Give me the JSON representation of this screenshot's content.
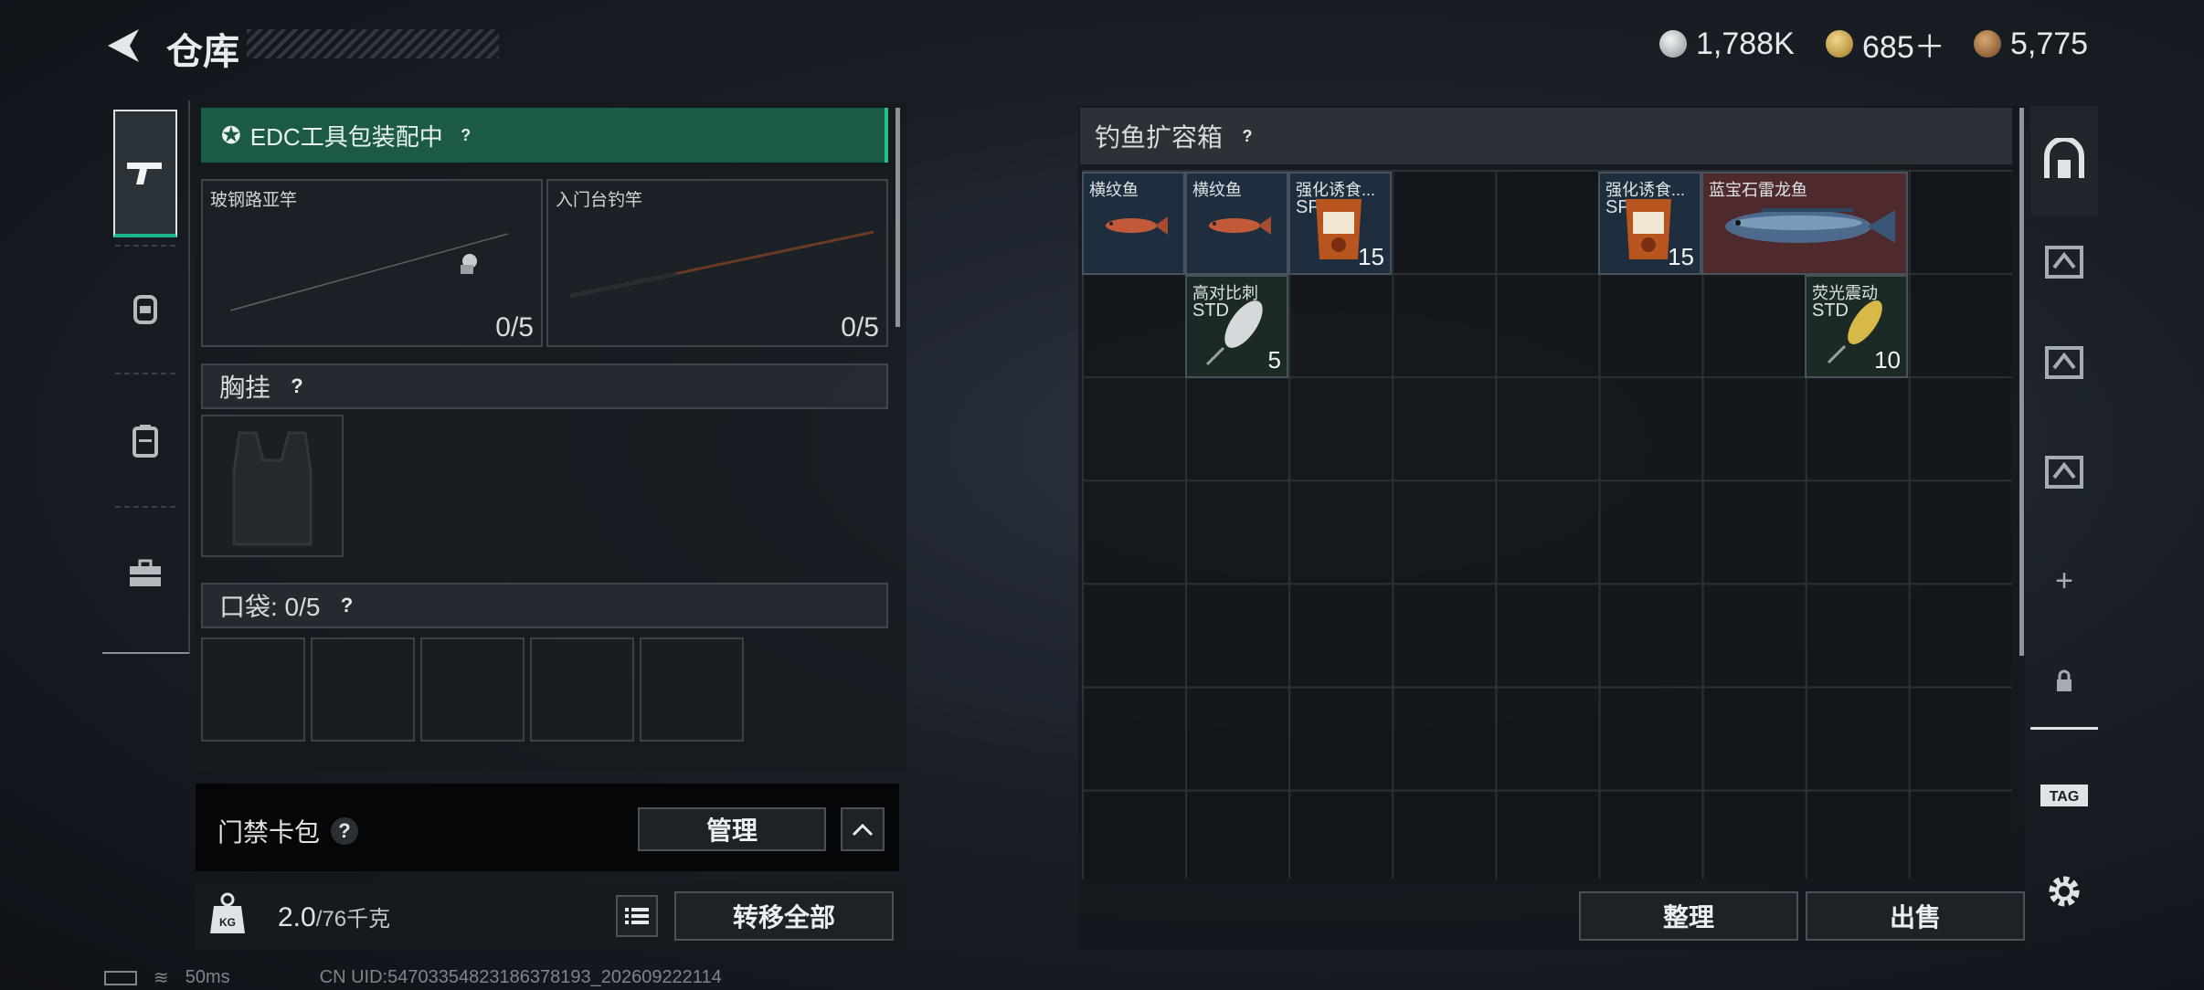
{
  "header": {
    "title": "仓库",
    "currencies": [
      {
        "icon": "silver-coin-icon",
        "value": "1,788K",
        "color": "#c9ccce"
      },
      {
        "icon": "gold-triangle-coin-icon",
        "value": "685＋",
        "color": "#d2a94a"
      },
      {
        "icon": "bronze-coin-icon",
        "value": "5,775",
        "color": "#a87b45"
      }
    ]
  },
  "left_tabs": [
    {
      "icon": "gun-icon",
      "active": true
    },
    {
      "icon": "helmet-icon"
    },
    {
      "icon": "backpack-icon"
    },
    {
      "icon": "toolbox-icon"
    }
  ],
  "loadout": {
    "edc_banner": "EDC工具包装配中",
    "rods": [
      {
        "name": "玻钢路亚竿",
        "count": "0/5"
      },
      {
        "name": "入门台钓竿",
        "count": "0/5"
      }
    ],
    "chest_rig_label": "胸挂",
    "pocket_label": "口袋: 0/5",
    "help": "?"
  },
  "keycard": {
    "label": "门禁卡包",
    "manage_label": "管理"
  },
  "capacity": {
    "current": "2.0",
    "max": "/76千克",
    "transfer_label": "转移全部"
  },
  "stash": {
    "title": "钓鱼扩容箱",
    "items": [
      {
        "name": "横纹鱼",
        "tag": "",
        "count": ""
      },
      {
        "name": "横纹鱼",
        "tag": "",
        "count": ""
      },
      {
        "name": "强化诱食...",
        "tag": "SP",
        "count": "15"
      },
      {
        "name": "强化诱食...",
        "tag": "SP",
        "count": "15"
      },
      {
        "name": "蓝宝石雷龙鱼",
        "tag": "",
        "count": ""
      },
      {
        "name": "高对比刺",
        "tag": "STD",
        "count": "5"
      },
      {
        "name": "荧光震动",
        "tag": "STD",
        "count": "10"
      }
    ],
    "sort_label": "整理",
    "sell_label": "出售"
  },
  "right_nav": [
    {
      "icon": "stash-home-icon"
    },
    {
      "icon": "container-icon"
    },
    {
      "icon": "container-icon"
    },
    {
      "icon": "container-icon"
    },
    {
      "icon": "plus-icon",
      "text": "+"
    },
    {
      "icon": "lock-icon"
    },
    {
      "icon": "stash-tag-icon"
    },
    {
      "icon": "settings-gear-icon"
    }
  ],
  "status": {
    "ping": "50ms",
    "uid": "CN UID:54703354823186378193_202609222114"
  },
  "colors": {
    "accent_green": "#1a5a46",
    "rare_red": "#4e2a2c",
    "item_blue": "#1e2e3e",
    "item_green": "#1c2a26"
  }
}
